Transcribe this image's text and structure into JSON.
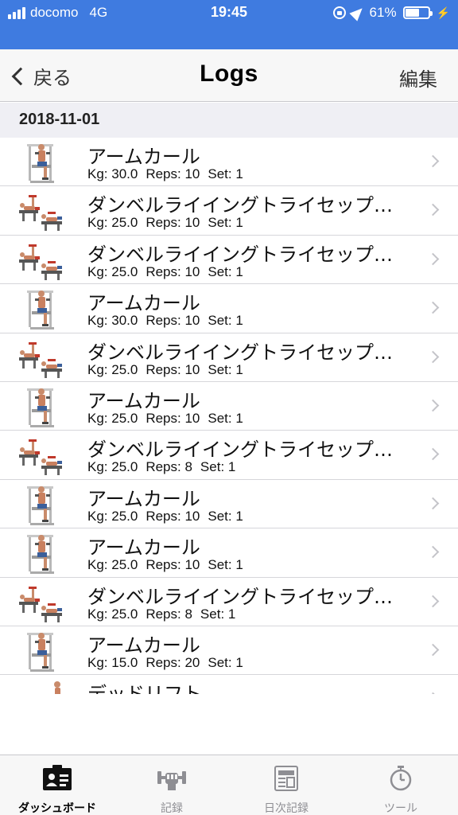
{
  "status_bar": {
    "carrier": "docomo",
    "network": "4G",
    "time": "19:45",
    "battery": "61%",
    "battery_level": 0.61
  },
  "nav": {
    "back_label": "戻る",
    "title": "Logs",
    "edit_label": "編集"
  },
  "section": {
    "date": "2018-11-01"
  },
  "logs": [
    {
      "name": "アームカール",
      "kg": "Kg: 30.0",
      "reps": "Reps: 10",
      "set": "Set: 1",
      "icon": "arm-curl-icon"
    },
    {
      "name": "ダンベルライイングトライセップ…",
      "kg": "Kg: 25.0",
      "reps": "Reps: 10",
      "set": "Set: 1",
      "icon": "dumbbell-lying-triceps-icon"
    },
    {
      "name": "ダンベルライイングトライセップ…",
      "kg": "Kg: 25.0",
      "reps": "Reps: 10",
      "set": "Set: 1",
      "icon": "dumbbell-lying-triceps-icon"
    },
    {
      "name": "アームカール",
      "kg": "Kg: 30.0",
      "reps": "Reps: 10",
      "set": "Set: 1",
      "icon": "arm-curl-icon"
    },
    {
      "name": "ダンベルライイングトライセップ…",
      "kg": "Kg: 25.0",
      "reps": "Reps: 10",
      "set": "Set: 1",
      "icon": "dumbbell-lying-triceps-icon"
    },
    {
      "name": "アームカール",
      "kg": "Kg: 25.0",
      "reps": "Reps: 10",
      "set": "Set: 1",
      "icon": "arm-curl-icon"
    },
    {
      "name": "ダンベルライイングトライセップ…",
      "kg": "Kg: 25.0",
      "reps": "Reps: 8",
      "set": "Set: 1",
      "icon": "dumbbell-lying-triceps-icon"
    },
    {
      "name": "アームカール",
      "kg": "Kg: 25.0",
      "reps": "Reps: 10",
      "set": "Set: 1",
      "icon": "arm-curl-icon"
    },
    {
      "name": "アームカール",
      "kg": "Kg: 25.0",
      "reps": "Reps: 10",
      "set": "Set: 1",
      "icon": "arm-curl-icon"
    },
    {
      "name": "ダンベルライイングトライセップ…",
      "kg": "Kg: 25.0",
      "reps": "Reps: 8",
      "set": "Set: 1",
      "icon": "dumbbell-lying-triceps-icon"
    },
    {
      "name": "アームカール",
      "kg": "Kg: 15.0",
      "reps": "Reps: 20",
      "set": "Set: 1",
      "icon": "arm-curl-icon"
    },
    {
      "name": "デッドリフト",
      "kg": "",
      "reps": "",
      "set": "",
      "icon": "deadlift-icon"
    }
  ],
  "tabs": [
    {
      "label": "ダッシュボード",
      "icon": "dashboard-id-card-icon",
      "active": true
    },
    {
      "label": "記録",
      "icon": "dumbbell-fist-icon",
      "active": false
    },
    {
      "label": "日次記録",
      "icon": "daily-log-document-icon",
      "active": false
    },
    {
      "label": "ツール",
      "icon": "stopwatch-icon",
      "active": false
    }
  ],
  "colors": {
    "status_bar": "#3f7be0",
    "nav_background": "#f7f7f7",
    "section_background": "#efeff4",
    "tab_active": "#000000",
    "tab_inactive": "#8e8e93"
  }
}
